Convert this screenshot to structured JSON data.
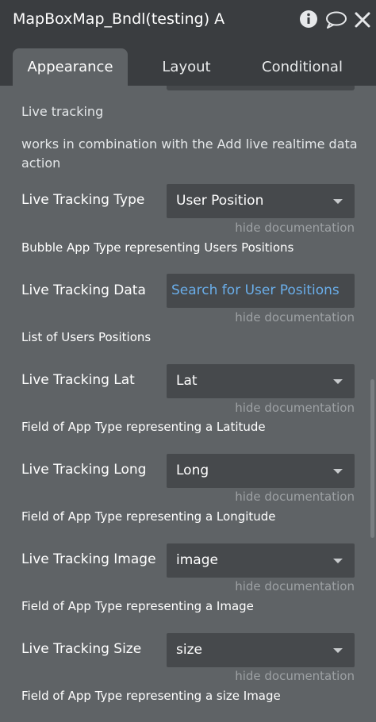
{
  "header": {
    "title": "MapBoxMap_Bndl(testing) A",
    "icons": [
      "info-icon",
      "comment-icon",
      "close-icon"
    ]
  },
  "tabs": [
    {
      "label": "Appearance",
      "active": true
    },
    {
      "label": "Layout",
      "active": false
    },
    {
      "label": "Conditional",
      "active": false
    }
  ],
  "section": {
    "title": "Live tracking",
    "description": "works in combination with the Add live realtime data action"
  },
  "hide_doc_label": "hide documentation",
  "fields": [
    {
      "label": "Live Tracking Type",
      "value": "User Position",
      "kind": "dropdown",
      "doc": "Bubble App Type representing Users Positions"
    },
    {
      "label": "Live Tracking Data",
      "value": "Search for User Positions",
      "kind": "search",
      "doc": "List of Users Positions"
    },
    {
      "label": "Live Tracking Lat",
      "value": "Lat",
      "kind": "dropdown",
      "doc": "Field of App Type representing a Latitude"
    },
    {
      "label": "Live Tracking Long",
      "value": "Long",
      "kind": "dropdown",
      "doc": "Field of App Type representing a Longitude"
    },
    {
      "label": "Live Tracking Image",
      "value": "image",
      "kind": "dropdown",
      "doc": "Field of App Type representing a Image"
    },
    {
      "label": "Live Tracking Size",
      "value": "size",
      "kind": "dropdown",
      "doc": "Field of App Type representing a size Image"
    }
  ],
  "colors": {
    "header_bg": "#3a3d40",
    "panel_bg": "#5f6366",
    "field_bg": "#46494c",
    "link_blue": "#6aaeea",
    "muted_text": "#9da1a4"
  }
}
